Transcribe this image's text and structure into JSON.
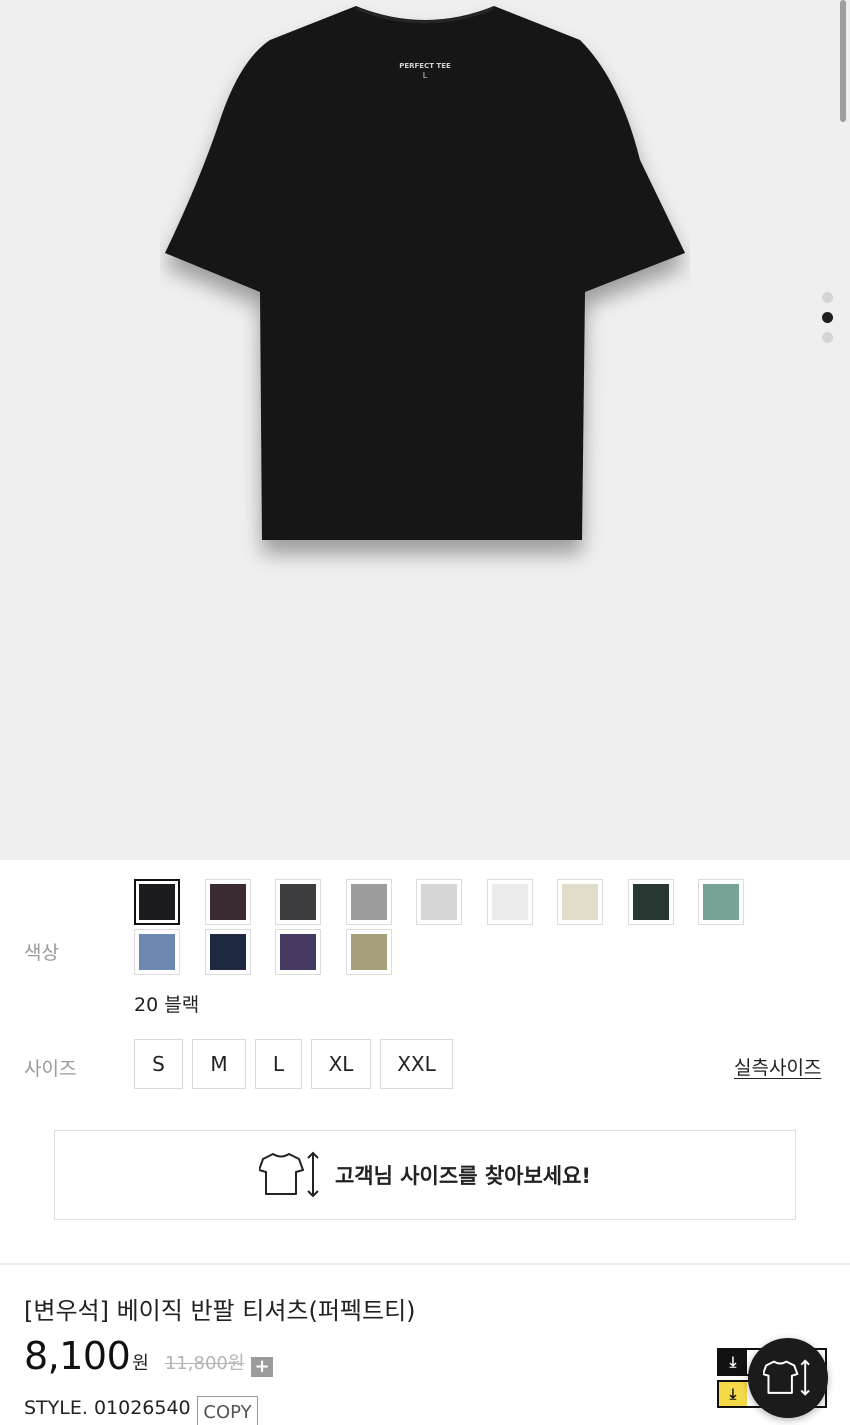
{
  "product_image": {
    "label_lines": [
      "PERFECT TEE",
      "L"
    ]
  },
  "gallery": {
    "count": 3,
    "active_index": 1
  },
  "options": {
    "color_label": "색상",
    "colors": [
      {
        "hex": "#1c1c1e",
        "selected": true
      },
      {
        "hex": "#3b2b35"
      },
      {
        "hex": "#3e3e40"
      },
      {
        "hex": "#9c9c9c"
      },
      {
        "hex": "#d6d6d6"
      },
      {
        "hex": "#ececec"
      },
      {
        "hex": "#e2dccb"
      },
      {
        "hex": "#283731"
      },
      {
        "hex": "#76a298"
      },
      {
        "hex": "#6d89b1"
      },
      {
        "hex": "#1e2840"
      },
      {
        "hex": "#463a63"
      },
      {
        "hex": "#a79f79"
      }
    ],
    "selected_color_name": "20 블랙",
    "size_label": "사이즈",
    "sizes": [
      "S",
      "M",
      "L",
      "XL",
      "XXL"
    ],
    "measure_link": "실측사이즈",
    "size_finder_text": "고객님 사이즈를 찾아보세요!"
  },
  "product": {
    "title": "[변우석] 베이직 반팔 티셔츠(퍼펙트티)",
    "price": "8,100",
    "price_unit": "원",
    "original_price": "11,800원",
    "plus_symbol": "+",
    "style_code": "STYLE. 01026540",
    "copy_label": "COPY"
  },
  "icons": {
    "coupon_download_1": "download-icon",
    "coupon_download_2": "download-icon",
    "size_finder": "tshirt-size-icon",
    "fab": "tshirt-size-icon"
  }
}
